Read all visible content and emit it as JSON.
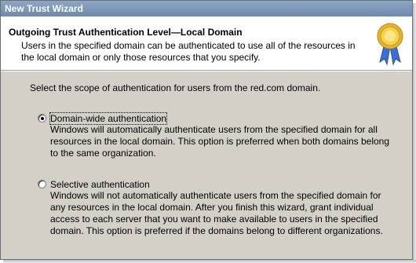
{
  "window": {
    "title": "New Trust Wizard"
  },
  "header": {
    "title": "Outgoing Trust Authentication Level—Local Domain",
    "subtitle": "Users in the specified domain can be authenticated to use all of the resources in the local domain or only those resources that you specify.",
    "icon": "certificate-ribbon-icon"
  },
  "body": {
    "intro": "Select the scope of authentication for users from the red.com domain.",
    "options": [
      {
        "label": "Domain-wide authentication",
        "description": "Windows will automatically authenticate users from the specified domain for all resources in the local domain. This option is preferred when both domains belong to the same organization.",
        "selected": true
      },
      {
        "label": "Selective authentication",
        "description": "Windows will not automatically authenticate users from the specified domain for any resources in the local domain. After you finish this wizard, grant individual access to each server that you want to make available to users in the specified domain. This option is preferred if the domains belong to different organizations.",
        "selected": false
      }
    ]
  }
}
